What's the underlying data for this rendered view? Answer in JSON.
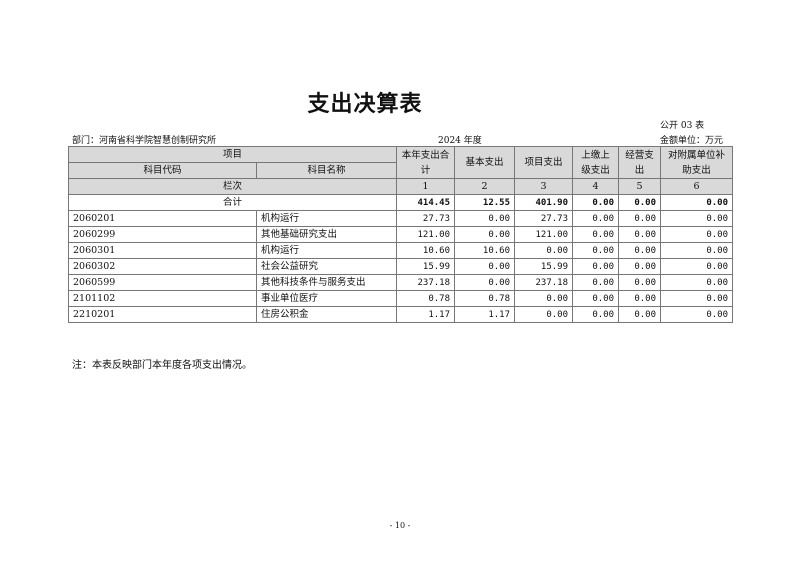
{
  "title": "支出决算表",
  "form_no": "公开 03 表",
  "department": "部门：河南省科学院智慧创制研究所",
  "year": "2024 年度",
  "unit": "金额单位：万元",
  "header": {
    "item": "项目",
    "code": "科目代码",
    "name": "科目名称",
    "total": "本年支出合计",
    "basic": "基本支出",
    "project": "项目支出",
    "upper": "上缴上级支出",
    "business": "经营支出",
    "subsidiary": "对附属单位补助支出"
  },
  "index_row": {
    "label": "栏次",
    "cols": [
      "1",
      "2",
      "3",
      "4",
      "5",
      "6"
    ]
  },
  "total_row": {
    "label": "合计",
    "cols": [
      "414.45",
      "12.55",
      "401.90",
      "0.00",
      "0.00",
      "0.00"
    ]
  },
  "rows": [
    {
      "code": "2060201",
      "name": "机构运行",
      "cols": [
        "27.73",
        "0.00",
        "27.73",
        "0.00",
        "0.00",
        "0.00"
      ]
    },
    {
      "code": "2060299",
      "name": "其他基础研究支出",
      "cols": [
        "121.00",
        "0.00",
        "121.00",
        "0.00",
        "0.00",
        "0.00"
      ]
    },
    {
      "code": "2060301",
      "name": "机构运行",
      "cols": [
        "10.60",
        "10.60",
        "0.00",
        "0.00",
        "0.00",
        "0.00"
      ]
    },
    {
      "code": "2060302",
      "name": "社会公益研究",
      "cols": [
        "15.99",
        "0.00",
        "15.99",
        "0.00",
        "0.00",
        "0.00"
      ]
    },
    {
      "code": "2060599",
      "name": "其他科技条件与服务支出",
      "cols": [
        "237.18",
        "0.00",
        "237.18",
        "0.00",
        "0.00",
        "0.00"
      ]
    },
    {
      "code": "2101102",
      "name": "事业单位医疗",
      "cols": [
        "0.78",
        "0.78",
        "0.00",
        "0.00",
        "0.00",
        "0.00"
      ]
    },
    {
      "code": "2210201",
      "name": "住房公积金",
      "cols": [
        "1.17",
        "1.17",
        "0.00",
        "0.00",
        "0.00",
        "0.00"
      ]
    }
  ],
  "note": "注：本表反映部门本年度各项支出情况。",
  "page_number": "- 10 -"
}
